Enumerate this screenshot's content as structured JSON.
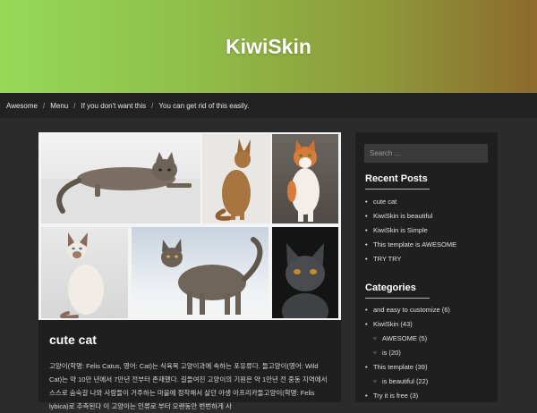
{
  "site": {
    "title": "KiwiSkin"
  },
  "breadcrumb": [
    "Awesome",
    "Menu",
    "If you don't want this",
    "You can get rid of this easily."
  ],
  "post": {
    "title": "cute cat",
    "body": "고양이(학명: Felis Catus, 영어: Cat)는 식육목 고양이과에 속하는 포유류다. 들고양이(영어: Wild Cat)는 약 10만 년에서 7만년 전부터 존재했다. 길들여진 고양이의 기원은 약 1만년 전 중동 지역에서 스스로 숨숙갈 나와 사람들이 거주하는 마을에 정착해서 살던 야생 아프리카들고양이(학명: Felis lybica)로 추측된다 이 고양이는 인류로 부터 오랜동안 번번하게 사"
  },
  "sidebar": {
    "search_placeholder": "Search ...",
    "recent_title": "Recent Posts",
    "recent_posts": [
      "cute cat",
      "KiwiSkin is beautiful",
      "KiwiSkin is Simple",
      "This template is AWESOME",
      "TRY TRY"
    ],
    "categories_title": "Categories",
    "categories": [
      {
        "label": "and easy to customize (6)",
        "sub": false
      },
      {
        "label": "KiwiSkin (43)",
        "sub": false
      },
      {
        "label": "AWESOME (5)",
        "sub": true
      },
      {
        "label": "is (20)",
        "sub": true
      },
      {
        "label": "This template (39)",
        "sub": false
      },
      {
        "label": "is beautiful (22)",
        "sub": true
      },
      {
        "label": "Try it is free (3)",
        "sub": false
      }
    ]
  },
  "colors": {
    "header_start": "#96d957",
    "header_end": "#8c6a2c",
    "accent": "#96d957",
    "background": "#2b2b2b",
    "panel": "#1f1f1f"
  }
}
